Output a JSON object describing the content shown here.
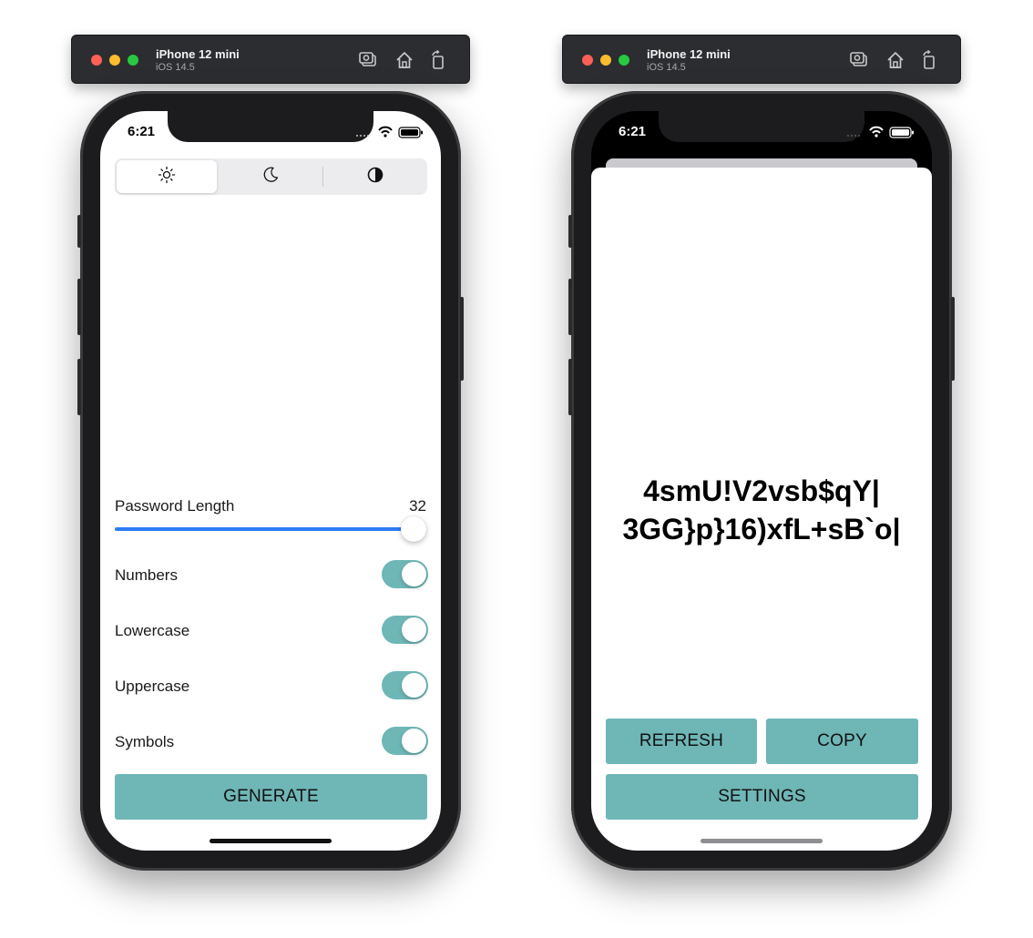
{
  "colors": {
    "accent_teal": "#6fb6b6",
    "slider_blue": "#2e7cf6",
    "titlebar": "#2b2d30"
  },
  "left_window": {
    "title": "iPhone 12 mini",
    "subtitle": "iOS 14.5",
    "status_time": "6:21",
    "appearance_modes": [
      "sun-icon",
      "moon-icon",
      "contrast-icon"
    ],
    "password_length_label": "Password Length",
    "password_length_value": "32",
    "password_length_slider_fraction": 1.0,
    "options": [
      {
        "label": "Numbers",
        "on": true
      },
      {
        "label": "Lowercase",
        "on": true
      },
      {
        "label": "Uppercase",
        "on": true
      },
      {
        "label": "Symbols",
        "on": true
      }
    ],
    "generate_label": "GENERATE"
  },
  "right_window": {
    "title": "iPhone 12 mini",
    "subtitle": "iOS 14.5",
    "status_time": "6:21",
    "password_line1": "4smU!V2vsb$qY|",
    "password_line2": "3GG}p}16)xfL+sB`o|",
    "refresh_label": "REFRESH",
    "copy_label": "COPY",
    "settings_label": "SETTINGS"
  }
}
